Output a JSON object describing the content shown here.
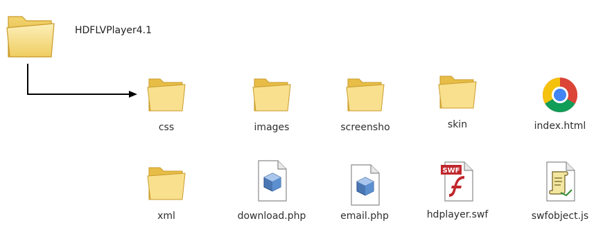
{
  "root": {
    "name": "HDFLVPlayer4.1",
    "icon": "folder-icon"
  },
  "items": [
    {
      "name": "css",
      "icon": "folder-icon"
    },
    {
      "name": "images",
      "icon": "folder-icon"
    },
    {
      "name": "screensho",
      "icon": "folder-icon"
    },
    {
      "name": "skin",
      "icon": "folder-icon"
    },
    {
      "name": "index.html",
      "icon": "chrome-icon"
    },
    {
      "name": "xml",
      "icon": "folder-icon"
    },
    {
      "name": "download.php",
      "icon": "php-file-icon"
    },
    {
      "name": "email.php",
      "icon": "php-file-icon"
    },
    {
      "name": "hdplayer.swf",
      "icon": "swf-file-icon"
    },
    {
      "name": "swfobject.js",
      "icon": "script-file-icon"
    }
  ],
  "swf_badge": "SWF",
  "colors": {
    "folder_back": "#e9c24e",
    "folder_front": "#f8e08e",
    "folder_edge": "#c99a2a",
    "arrow": "#000000"
  }
}
